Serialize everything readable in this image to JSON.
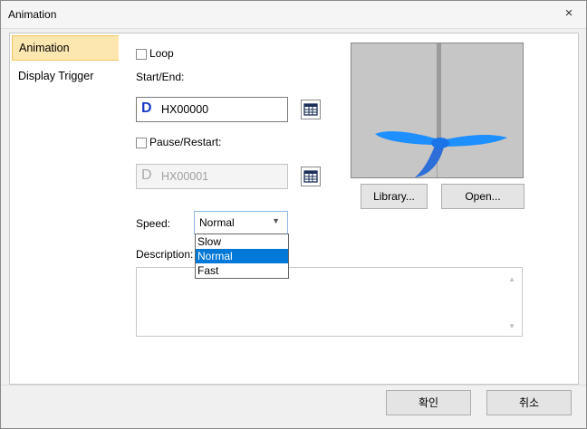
{
  "window": {
    "title": "Animation",
    "close_glyph": "×"
  },
  "sidebar": {
    "items": [
      {
        "label": "Animation",
        "selected": true
      },
      {
        "label": "Display Trigger",
        "selected": false
      }
    ]
  },
  "loop": {
    "label": "Loop",
    "checked": false
  },
  "start_end": {
    "label": "Start/End:",
    "prefix": "D",
    "value": "HX00000"
  },
  "pause_restart": {
    "label": "Pause/Restart:",
    "checked": false,
    "prefix": "D",
    "value": "HX00001"
  },
  "preview_buttons": {
    "library": "Library...",
    "open": "Open..."
  },
  "speed": {
    "label": "Speed:",
    "selected": "Normal",
    "options": [
      "Slow",
      "Normal",
      "Fast"
    ]
  },
  "description": {
    "label": "Description:",
    "value": ""
  },
  "footer": {
    "ok": "확인",
    "cancel": "취소"
  },
  "colors": {
    "accent": "#0078d7",
    "selected_item_bg": "#fde7b0",
    "device_prefix": "#1a3cc6",
    "propeller": "#1e8fff"
  }
}
